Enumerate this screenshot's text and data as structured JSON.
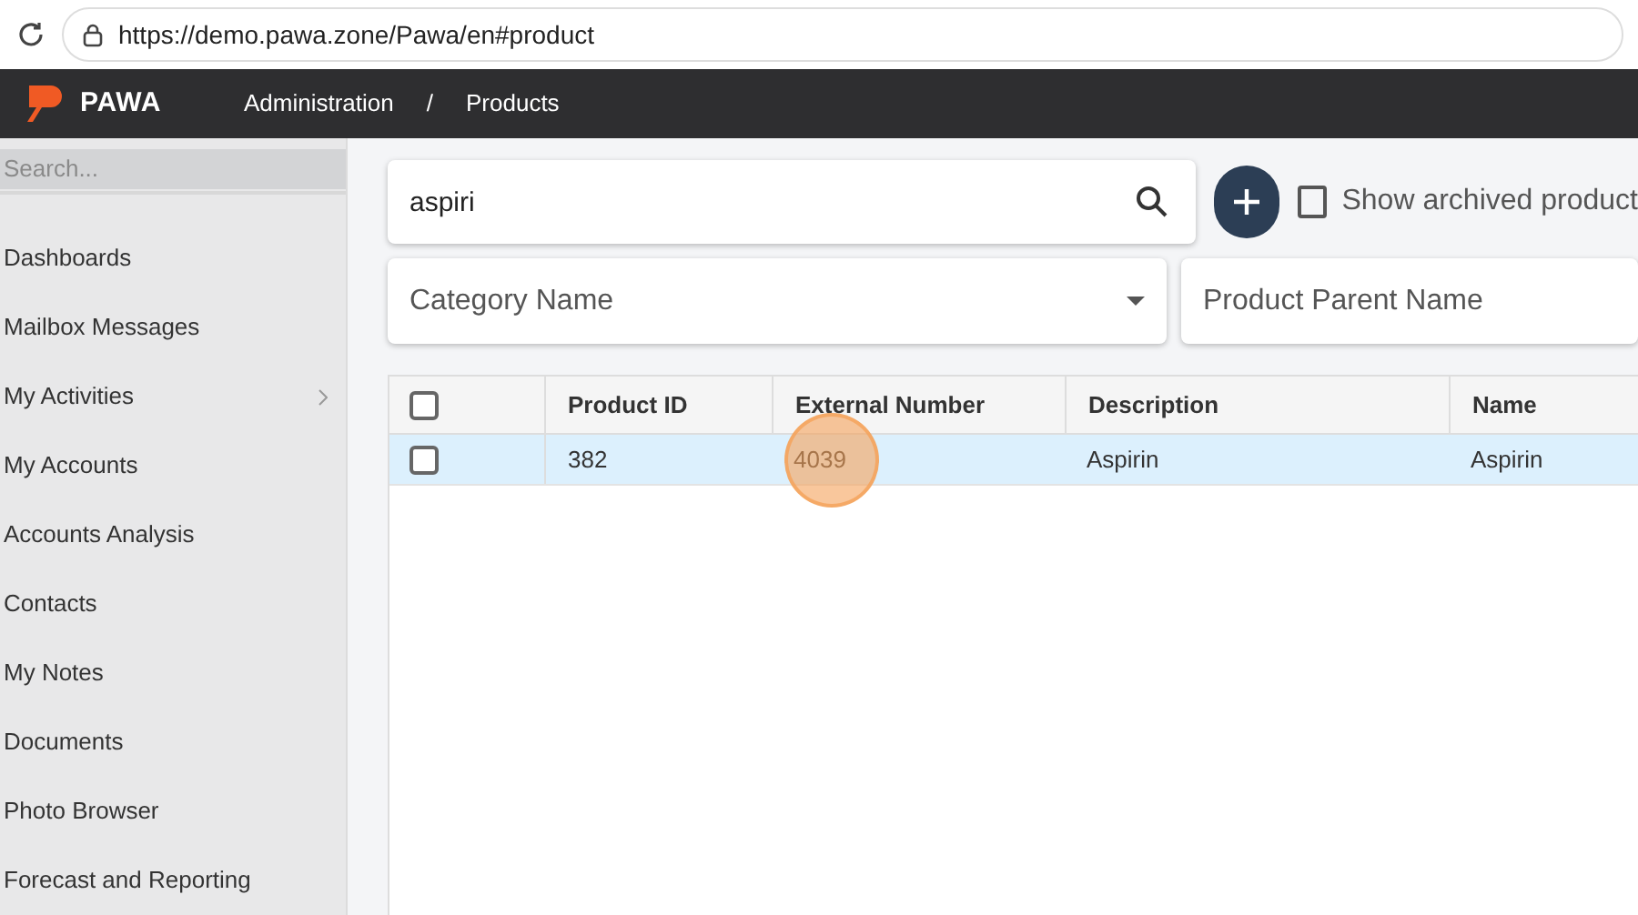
{
  "browser": {
    "url": "https://demo.pawa.zone/Pawa/en#product"
  },
  "header": {
    "logo": "PAWA",
    "breadcrumb": [
      "Administration",
      "/",
      "Products"
    ]
  },
  "sidebar": {
    "search_placeholder": "Search...",
    "items": [
      {
        "label": "Dashboards",
        "expandable": false
      },
      {
        "label": "Mailbox Messages",
        "expandable": false
      },
      {
        "label": "My Activities",
        "expandable": true
      },
      {
        "label": "My Accounts",
        "expandable": false
      },
      {
        "label": "Accounts Analysis",
        "expandable": false
      },
      {
        "label": "Contacts",
        "expandable": false
      },
      {
        "label": "My Notes",
        "expandable": false
      },
      {
        "label": "Documents",
        "expandable": false
      },
      {
        "label": "Photo Browser",
        "expandable": false
      },
      {
        "label": "Forecast and Reporting",
        "expandable": false
      }
    ]
  },
  "search": {
    "value": "aspiri"
  },
  "show_archived": {
    "label": "Show archived product",
    "checked": false
  },
  "filters": {
    "category": {
      "placeholder": "Category Name"
    },
    "parent": {
      "placeholder": "Product Parent Name"
    }
  },
  "table": {
    "header_checked": false,
    "columns": [
      "Product ID",
      "External Number",
      "Description",
      "Name"
    ],
    "rows": [
      {
        "selected": true,
        "checked": false,
        "cells": [
          {
            "text": "382",
            "clicked": false
          },
          {
            "text": "4039",
            "clicked": true
          },
          {
            "text": "Aspirin",
            "clicked": false
          },
          {
            "text": "Aspirin",
            "clicked": false
          }
        ]
      }
    ]
  }
}
